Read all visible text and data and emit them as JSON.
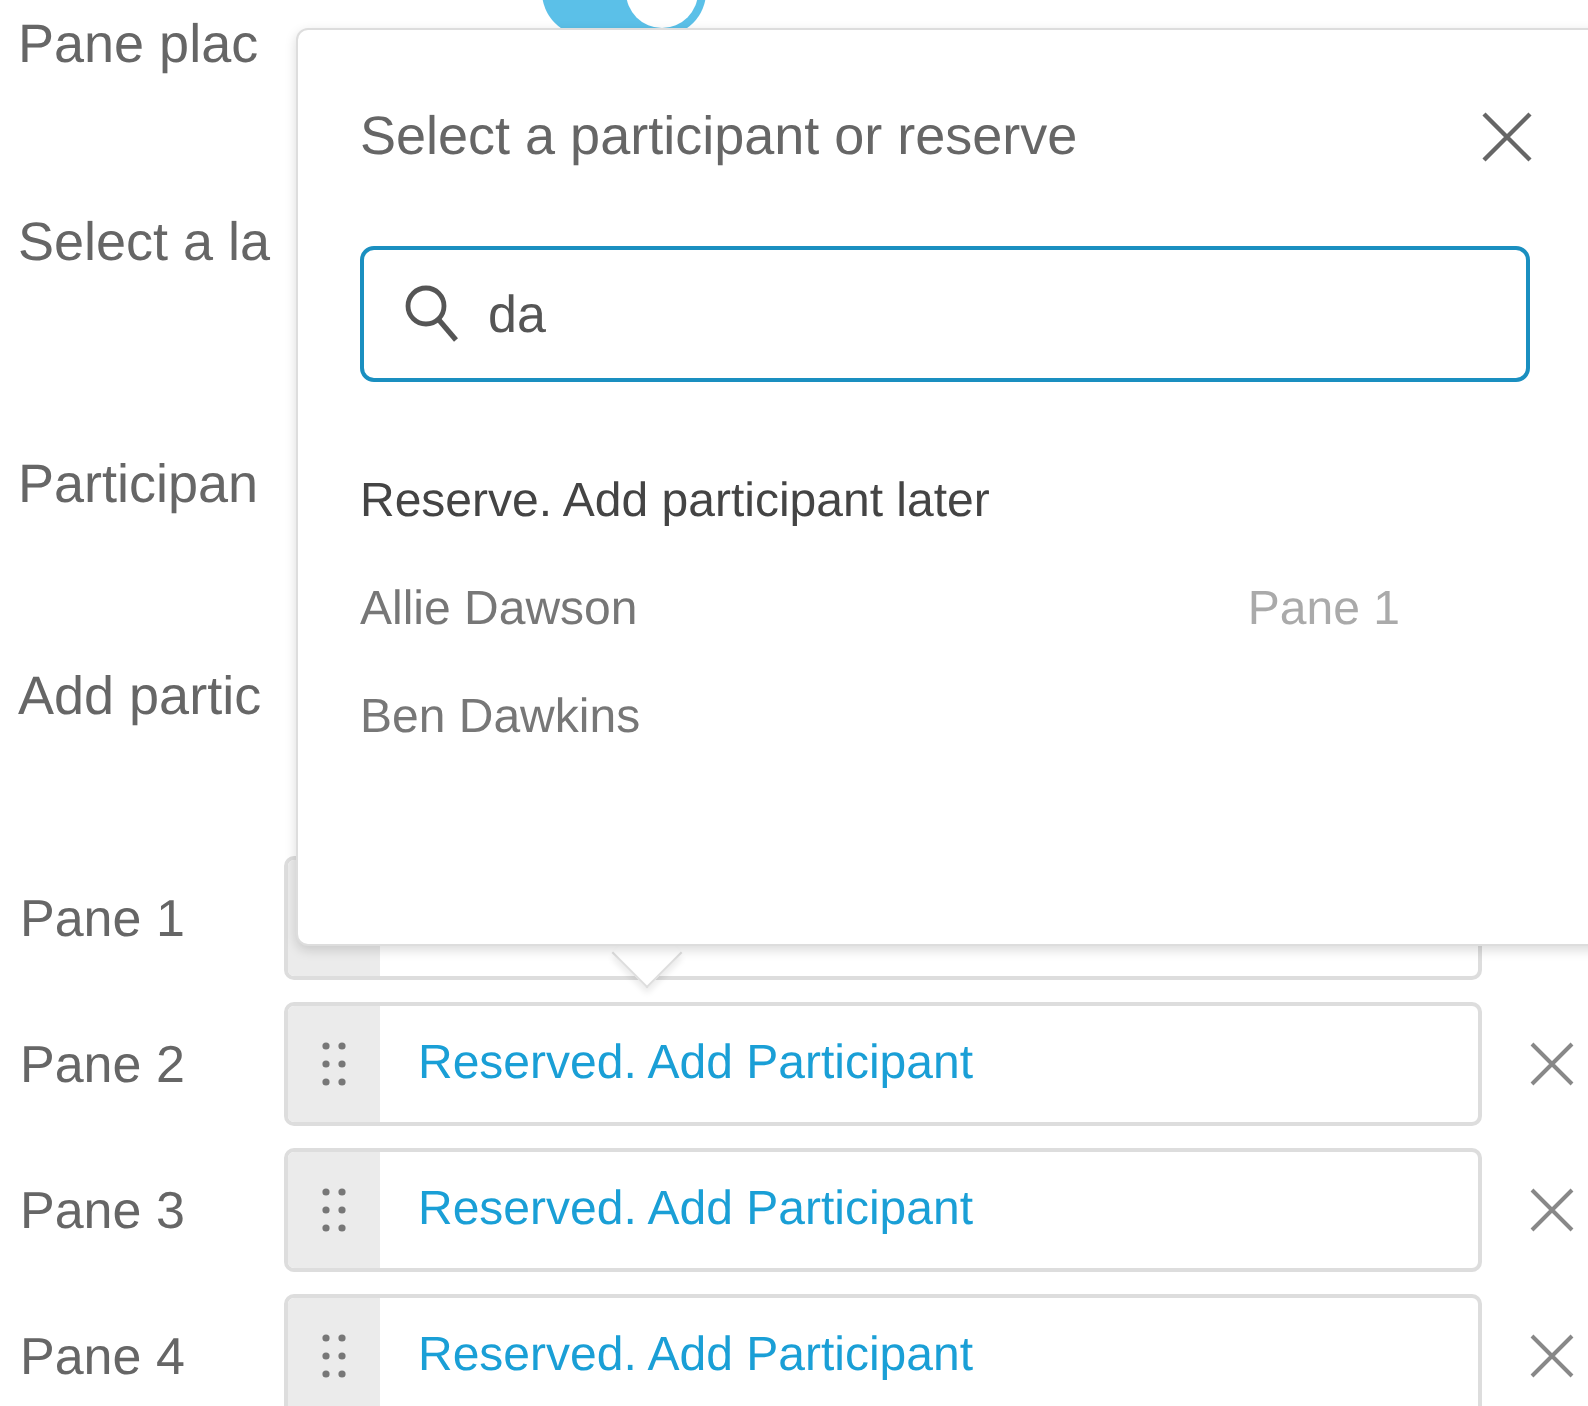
{
  "settings": [
    {
      "kind": "toggle",
      "label": "Pane plac",
      "on": true
    },
    {
      "kind": "text",
      "label": "Select a la"
    },
    {
      "kind": "text",
      "label": "Participan"
    },
    {
      "kind": "heading",
      "label": "Add partic"
    }
  ],
  "panes": [
    {
      "label": "Pane 1"
    },
    {
      "label": "Pane 2",
      "value": "Reserved. Add Participant"
    },
    {
      "label": "Pane 3",
      "value": "Reserved. Add Participant"
    },
    {
      "label": "Pane 4",
      "value": "Reserved. Add Participant"
    }
  ],
  "popup": {
    "title": "Select a participant or reserve",
    "search": {
      "value": "da"
    },
    "options": [
      {
        "kind": "reserve",
        "label": "Reserve. Add participant later"
      },
      {
        "kind": "participant",
        "label": "Allie Dawson",
        "pane": "Pane 1"
      },
      {
        "kind": "participant",
        "label": "Ben Dawkins"
      }
    ]
  }
}
